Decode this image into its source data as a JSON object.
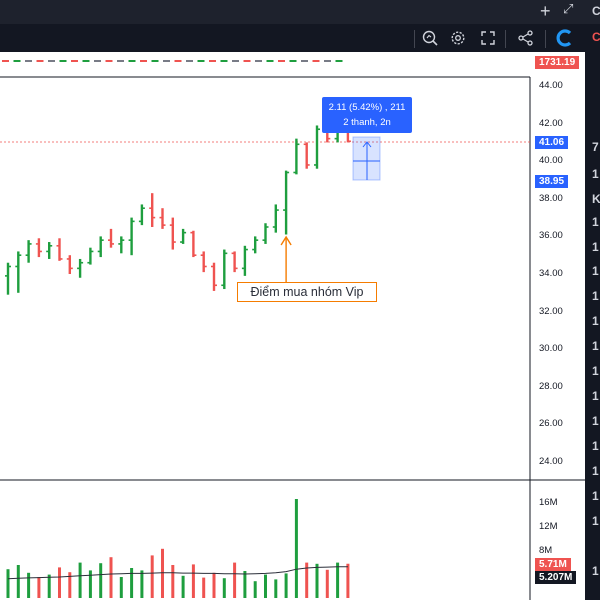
{
  "window": {
    "plus_label": "+",
    "expand_label": "⤢"
  },
  "toolbar": {
    "icons": [
      "zoom-icon",
      "gear-icon",
      "fullscreen-icon",
      "share-icon",
      "app-logo-icon"
    ]
  },
  "right_strip": {
    "letters": [
      "C",
      "C",
      "7",
      "1",
      "K",
      "1",
      "1",
      "1",
      "1",
      "1",
      "1",
      "1",
      "1",
      "1",
      "1",
      "1",
      "1",
      "1",
      "1"
    ]
  },
  "index_badge": "1731.19",
  "tooltip": {
    "line1": "2.11 (5.42%) , 211",
    "line2": "2 thanh, 2n"
  },
  "annotation": "Điểm mua nhóm Vip",
  "price_axis": {
    "labels": [
      "44.00",
      "42.00",
      "40.00",
      "38.00",
      "36.00",
      "34.00",
      "32.00",
      "30.00",
      "28.00",
      "26.00",
      "24.00"
    ],
    "current_price": "41.06",
    "range_low": "38.95"
  },
  "volume_axis": {
    "labels": [
      "16M",
      "12M",
      "8M"
    ],
    "current_volume": "5.71M",
    "average_volume": "5.207M"
  },
  "colors": {
    "up": "#26a69a",
    "up_bar": "#1e9e3e",
    "down": "#ef5350",
    "accent": "#2962ff",
    "annotation_border": "#f57c00",
    "badge_red": "#ef5350",
    "badge_dark": "#131722"
  },
  "chart_data": {
    "type": "ohlc",
    "ylim": [
      23,
      45
    ],
    "bars": [
      {
        "o": 33.9,
        "h": 34.6,
        "l": 32.9,
        "c": 34.4
      },
      {
        "o": 34.4,
        "h": 35.2,
        "l": 33.0,
        "c": 35.0
      },
      {
        "o": 35.0,
        "h": 35.8,
        "l": 34.6,
        "c": 35.6
      },
      {
        "o": 35.6,
        "h": 35.9,
        "l": 34.9,
        "c": 35.2
      },
      {
        "o": 35.2,
        "h": 35.7,
        "l": 34.8,
        "c": 35.5
      },
      {
        "o": 35.5,
        "h": 35.9,
        "l": 34.7,
        "c": 34.8
      },
      {
        "o": 34.8,
        "h": 35.0,
        "l": 34.0,
        "c": 34.3
      },
      {
        "o": 34.3,
        "h": 34.8,
        "l": 33.8,
        "c": 34.6
      },
      {
        "o": 34.6,
        "h": 35.4,
        "l": 34.5,
        "c": 35.2
      },
      {
        "o": 35.2,
        "h": 36.0,
        "l": 34.9,
        "c": 35.8
      },
      {
        "o": 35.8,
        "h": 36.4,
        "l": 35.4,
        "c": 35.6
      },
      {
        "o": 35.6,
        "h": 36.0,
        "l": 35.1,
        "c": 35.8
      },
      {
        "o": 35.8,
        "h": 37.0,
        "l": 35.0,
        "c": 36.8
      },
      {
        "o": 36.8,
        "h": 37.7,
        "l": 36.6,
        "c": 37.5
      },
      {
        "o": 37.5,
        "h": 38.3,
        "l": 36.5,
        "c": 37.0
      },
      {
        "o": 37.0,
        "h": 37.5,
        "l": 36.4,
        "c": 36.6
      },
      {
        "o": 36.6,
        "h": 37.0,
        "l": 35.3,
        "c": 35.7
      },
      {
        "o": 35.7,
        "h": 36.4,
        "l": 35.6,
        "c": 36.2
      },
      {
        "o": 36.2,
        "h": 36.3,
        "l": 34.9,
        "c": 35.0
      },
      {
        "o": 35.0,
        "h": 35.2,
        "l": 34.1,
        "c": 34.4
      },
      {
        "o": 34.4,
        "h": 34.6,
        "l": 33.1,
        "c": 33.4
      },
      {
        "o": 33.4,
        "h": 35.3,
        "l": 33.2,
        "c": 35.1
      },
      {
        "o": 35.1,
        "h": 35.2,
        "l": 34.1,
        "c": 34.3
      },
      {
        "o": 34.3,
        "h": 35.5,
        "l": 33.9,
        "c": 35.3
      },
      {
        "o": 35.3,
        "h": 36.0,
        "l": 35.1,
        "c": 35.8
      },
      {
        "o": 35.8,
        "h": 36.7,
        "l": 35.6,
        "c": 36.5
      },
      {
        "o": 36.5,
        "h": 37.7,
        "l": 36.2,
        "c": 37.4
      },
      {
        "o": 37.4,
        "h": 39.5,
        "l": 36.1,
        "c": 39.4
      },
      {
        "o": 39.4,
        "h": 41.2,
        "l": 39.3,
        "c": 40.9
      },
      {
        "o": 40.9,
        "h": 41.0,
        "l": 39.6,
        "c": 39.8
      },
      {
        "o": 39.8,
        "h": 41.9,
        "l": 39.6,
        "c": 41.7
      },
      {
        "o": 41.7,
        "h": 42.6,
        "l": 41.0,
        "c": 41.2
      },
      {
        "o": 41.2,
        "h": 41.9,
        "l": 41.0,
        "c": 41.6
      },
      {
        "o": 41.6,
        "h": 41.8,
        "l": 41.0,
        "c": 41.06
      }
    ],
    "volume": [
      4.8,
      5.5,
      4.2,
      3.5,
      3.9,
      5.1,
      4.3,
      5.9,
      4.6,
      5.8,
      6.8,
      3.5,
      5.0,
      4.6,
      7.1,
      8.2,
      5.5,
      3.7,
      5.6,
      3.4,
      4.2,
      3.3,
      5.9,
      4.5,
      2.8,
      3.9,
      3.1,
      4.1,
      16.5,
      5.9,
      5.7,
      4.7,
      5.9,
      5.71
    ],
    "volume_ylim": [
      0,
      20
    ],
    "volume_ma": [
      3.2,
      3.3,
      3.35,
      3.4,
      3.45,
      3.5,
      3.6,
      3.7,
      3.8,
      3.9,
      4.0,
      4.05,
      4.1,
      4.1,
      4.15,
      4.2,
      4.2,
      4.15,
      4.15,
      4.1,
      4.1,
      4.05,
      4.05,
      4.0,
      4.05,
      4.1,
      4.2,
      4.4,
      4.8,
      5.0,
      5.1,
      5.15,
      5.2,
      5.207
    ]
  }
}
